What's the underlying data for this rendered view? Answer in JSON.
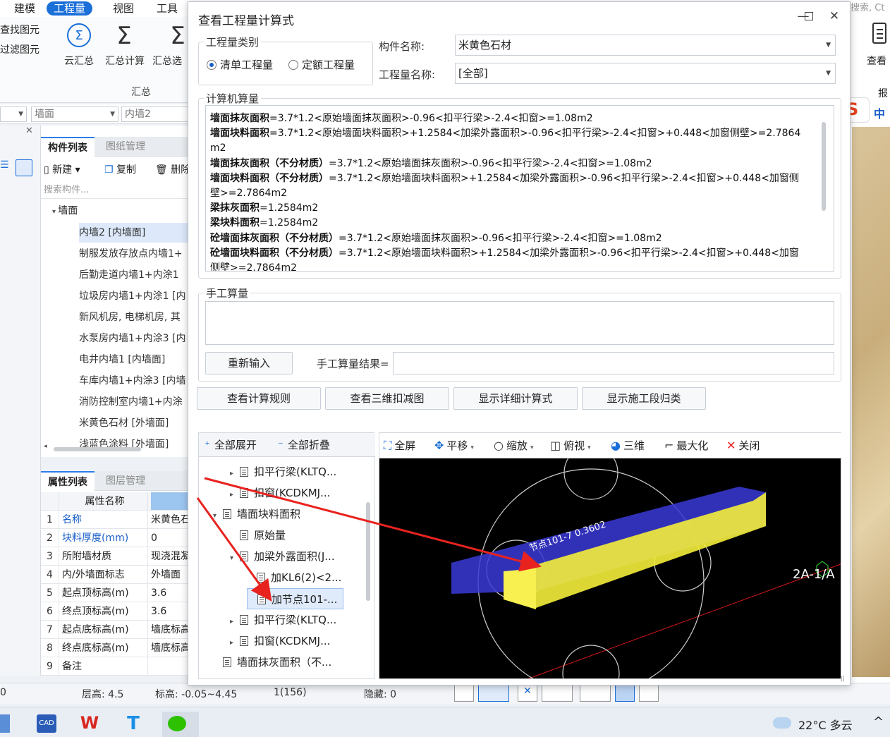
{
  "ribbon": {
    "tabs": [
      "建模",
      "工程量",
      "视图",
      "工具"
    ],
    "active_tab": "工程量",
    "left_links": [
      "查找图元",
      "过滤图元"
    ],
    "buttons": [
      "云汇总",
      "汇总计算",
      "汇总选"
    ],
    "group_label": "汇总",
    "search_hint": "搜索, Ct",
    "right_button": "查看",
    "right_label2": "报",
    "ime": "中"
  },
  "filter_bar": {
    "combo1": "",
    "combo2": "墙面",
    "combo3": "内墙2"
  },
  "component_panel": {
    "tabs": [
      "构件列表",
      "图纸管理"
    ],
    "toolbar": {
      "new": "新建",
      "copy": "复制",
      "delete": "删除"
    },
    "search_placeholder": "搜索构件...",
    "root": "墙面",
    "items": [
      "内墙2 [内墙面]",
      "制服发放存放点内墙1+",
      "后勤走道内墙1+内涂1",
      "垃圾房内墙1+内涂1 [内",
      "新风机房, 电梯机房, 其",
      "水泵房内墙1+内涂3 [内",
      "电井内墙1 [内墙面]",
      "车库内墙1+内涂3 [内墙",
      "消防控制室内墙1+内涂",
      "米黄色石材 [外墙面]",
      "浅蓝色涂料 [外墙面]"
    ]
  },
  "property_panel": {
    "tabs": [
      "属性列表",
      "图层管理"
    ],
    "header": "属性名称",
    "rows": [
      {
        "n": "1",
        "k": "名称",
        "v": "米黄色石",
        "blue": true
      },
      {
        "n": "2",
        "k": "块料厚度(mm)",
        "v": "0",
        "blue": true
      },
      {
        "n": "3",
        "k": "所附墙材质",
        "v": "现浇混凝",
        "blue": false
      },
      {
        "n": "4",
        "k": "内/外墙面标志",
        "v": "外墙面",
        "blue": false
      },
      {
        "n": "5",
        "k": "起点顶标高(m)",
        "v": "3.6",
        "blue": false
      },
      {
        "n": "6",
        "k": "终点顶标高(m)",
        "v": "3.6",
        "blue": false
      },
      {
        "n": "7",
        "k": "起点底标高(m)",
        "v": "墙底标高",
        "blue": false
      },
      {
        "n": "8",
        "k": "终点底标高(m)",
        "v": "墙底标高",
        "blue": false
      },
      {
        "n": "9",
        "k": "备注",
        "v": "",
        "blue": false
      }
    ]
  },
  "status_bar": {
    "left": "0",
    "floor_height": "层高:  4.5",
    "elevation": "标高:  -0.05~4.45",
    "count": "1(156)",
    "hidden": "隐藏:  0"
  },
  "taskbar": {
    "weather": "22°C  多云",
    "chevron": "^"
  },
  "dialog": {
    "title": "查看工程量计算式",
    "category_legend": "工程量类别",
    "radio_bill": "清单工程量",
    "radio_quota": "定额工程量",
    "component_name_label": "构件名称:",
    "component_name_value": "米黄色石材",
    "quantity_name_label": "工程量名称:",
    "quantity_name_value": "[全部]",
    "computed_legend": "计算机算量",
    "formula_lines": [
      {
        "bold": "墙面抹灰面积",
        "rest": "=3.7*1.2<原始墙面抹灰面积>-0.96<扣平行梁>-2.4<扣窗>=1.08m2"
      },
      {
        "bold": "墙面块料面积",
        "rest": "=3.7*1.2<原始墙面块料面积>+1.2584<加梁外露面积>-0.96<扣平行梁>-2.4<扣窗>+0.448<加窗侧壁>=2.7864"
      },
      {
        "bold": "",
        "rest": "m2"
      },
      {
        "bold": "墙面抹灰面积（不分材质）",
        "rest": "=3.7*1.2<原始墙面抹灰面积>-0.96<扣平行梁>-2.4<扣窗>=1.08m2"
      },
      {
        "bold": "墙面块料面积（不分材质）",
        "rest": "=3.7*1.2<原始墙面块料面积>+1.2584<加梁外露面积>-0.96<扣平行梁>-2.4<扣窗>+0.448<加窗侧"
      },
      {
        "bold": "",
        "rest": "壁>=2.7864m2"
      },
      {
        "bold": "梁抹灰面积",
        "rest": "=1.2584m2"
      },
      {
        "bold": "梁块料面积",
        "rest": "=1.2584m2"
      },
      {
        "bold": "砼墙面抹灰面积（不分材质）",
        "rest": "=3.7*1.2<原始墙面抹灰面积>-0.96<扣平行梁>-2.4<扣窗>=1.08m2"
      },
      {
        "bold": "砼墙面块料面积（不分材质）",
        "rest": "=3.7*1.2<原始墙面块料面积>+1.2584<加梁外露面积>-0.96<扣平行梁>-2.4<扣窗>+0.448<加窗"
      },
      {
        "bold": "",
        "rest": "侧壁>=2.7864m2"
      }
    ],
    "manual_legend": "手工算量",
    "reinput_button": "重新输入",
    "manual_result_label": "手工算量结果=",
    "action_buttons": [
      "查看计算规则",
      "查看三维扣减图",
      "显示详细计算式",
      "显示施工段归类"
    ],
    "tree_toolbar": {
      "expand_all": "全部展开",
      "collapse_all": "全部折叠"
    },
    "tree_items": [
      {
        "text": "扣平行梁(KLTQ...",
        "level": 2,
        "exp": "▸"
      },
      {
        "text": "扣窗(KCDKMJ...",
        "level": 2,
        "exp": "▸"
      },
      {
        "text": "墙面块料面积",
        "level": 1,
        "exp": "▾"
      },
      {
        "text": "原始量",
        "level": 2,
        "exp": ""
      },
      {
        "text": "加梁外露面积(J...",
        "level": 2,
        "exp": "▾"
      },
      {
        "text": "加KL6(2)<2...",
        "level": 3,
        "exp": ""
      },
      {
        "text": "加节点101-...",
        "level": 3,
        "exp": "",
        "selected": true
      },
      {
        "text": "扣平行梁(KLTQ...",
        "level": 2,
        "exp": "▸"
      },
      {
        "text": "扣窗(KCDKMJ...",
        "level": 2,
        "exp": "▸"
      },
      {
        "text": "墙面抹灰面积（不...",
        "level": 1,
        "exp": ""
      }
    ],
    "view_toolbar": [
      "全屏",
      "平移",
      "缩放",
      "俯视",
      "三维",
      "最大化",
      "关闭"
    ],
    "view_labels": {
      "node_label": "节点101-7 0.3602",
      "axis_label": "2A-1/A"
    }
  },
  "colors": {
    "accent": "#1a6fd8",
    "arrow": "#e8231f",
    "beam_yellow": "#f4ee3a",
    "beam_blue": "#3a3ad8"
  }
}
